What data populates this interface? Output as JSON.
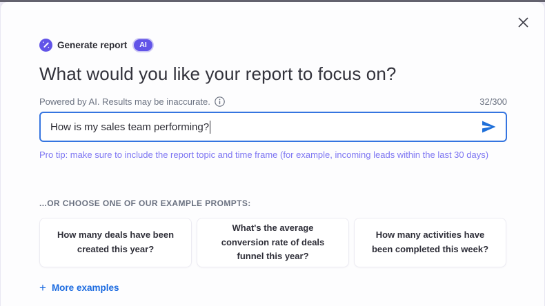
{
  "modal": {
    "header": {
      "title": "Generate report",
      "badge": "AI"
    },
    "heading": "What would you like your report to focus on?",
    "input_section": {
      "disclaimer": "Powered by AI. Results may be inaccurate.",
      "char_counter": "32/300",
      "value": "How is my sales team performing?",
      "placeholder": "",
      "pro_tip": "Pro tip: make sure to include the report topic and time frame (for example, incoming leads within the last 30 days)"
    },
    "examples": {
      "label": "...OR CHOOSE ONE OF OUR EXAMPLE PROMPTS:",
      "prompts": [
        "How many deals have been created this year?",
        "What's the average conversion rate of deals funnel this year?",
        "How many activities have been completed this week?"
      ],
      "more_label": "More examples",
      "plus_glyph": "+"
    },
    "icons": {
      "wand_icon": "magic-wand",
      "info_icon": "info-circle",
      "send_icon": "send-arrow",
      "close_icon": "close-x"
    },
    "colors": {
      "accent_purple": "#6254e8",
      "pro_tip_purple": "#7d75f2",
      "link_blue": "#1a6ae0",
      "send_blue": "#1e6fd9",
      "input_border_blue": "#3575e0",
      "heading_gray": "#32323b",
      "muted_gray": "#6a7180"
    }
  }
}
